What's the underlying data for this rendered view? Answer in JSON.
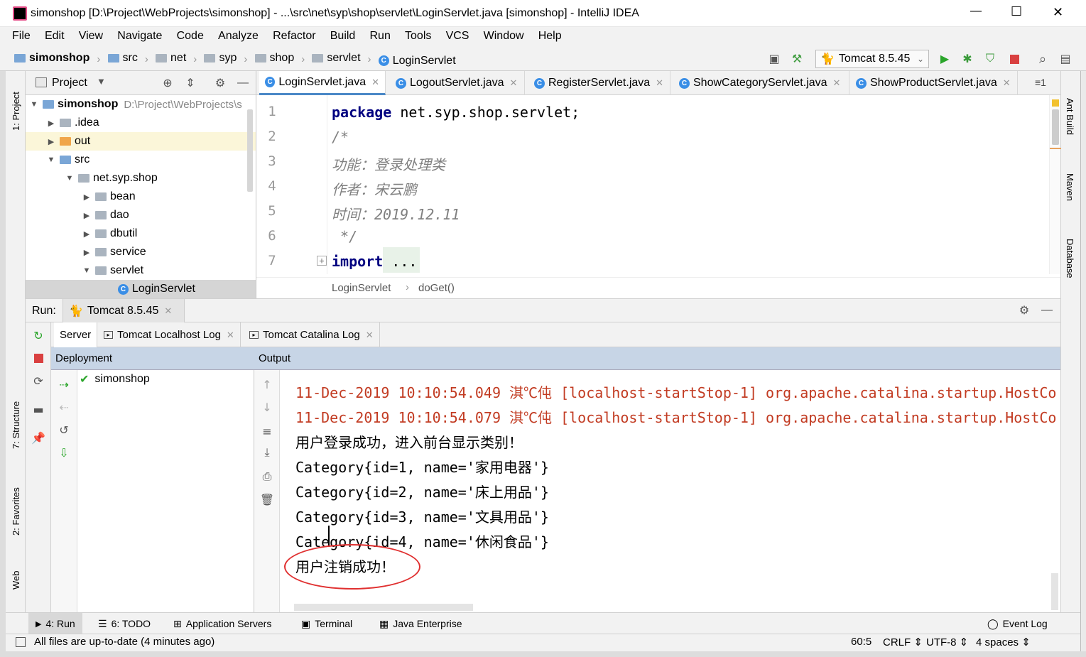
{
  "window": {
    "title": "simonshop [D:\\Project\\WebProjects\\simonshop] - ...\\src\\net\\syp\\shop\\servlet\\LoginServlet.java [simonshop] - IntelliJ IDEA",
    "minimize": "—",
    "maximize": "☐",
    "close": "✕"
  },
  "menu": [
    "File",
    "Edit",
    "View",
    "Navigate",
    "Code",
    "Analyze",
    "Refactor",
    "Build",
    "Run",
    "Tools",
    "VCS",
    "Window",
    "Help"
  ],
  "breadcrumbs": [
    "simonshop",
    "src",
    "net",
    "syp",
    "shop",
    "servlet",
    "LoginServlet"
  ],
  "run_config": "Tomcat 8.5.45",
  "project_panel": {
    "title": "Project",
    "tree": [
      {
        "label": "simonshop",
        "extra": "D:\\Project\\WebProjects\\s"
      },
      {
        "label": ".idea"
      },
      {
        "label": "out"
      },
      {
        "label": "src"
      },
      {
        "label": "net.syp.shop"
      },
      {
        "label": "bean"
      },
      {
        "label": "dao"
      },
      {
        "label": "dbutil"
      },
      {
        "label": "service"
      },
      {
        "label": "servlet"
      },
      {
        "label": "LoginServlet"
      }
    ]
  },
  "editor": {
    "tabs": [
      "LoginServlet.java",
      "LogoutServlet.java",
      "RegisterServlet.java",
      "ShowCategoryServlet.java",
      "ShowProductServlet.java"
    ],
    "tab_overflow": "≡1",
    "line_numbers": [
      "1",
      "2",
      "3",
      "4",
      "5",
      "6",
      "7"
    ],
    "lines": {
      "l1_kw": "package",
      "l1_rest": " net.syp.shop.servlet;",
      "l2": "/*",
      "l3": "功能：登录处理类",
      "l4": "作者：宋云鹏",
      "l5": "时间：2019.12.11",
      "l6": " */",
      "l7_kw": "import",
      "l7_rest": " ..."
    },
    "breadcrumb": [
      "LoginServlet",
      "doGet()"
    ]
  },
  "run_panel": {
    "label": "Run:",
    "config_tab": "Tomcat 8.5.45",
    "subtabs": [
      "Server",
      "Tomcat Localhost Log",
      "Tomcat Catalina Log"
    ],
    "deployment_header": "Deployment",
    "deployment_item": "simonshop",
    "output_header": "Output",
    "output_lines": [
      "11-Dec-2019 10:10:54.049 淇℃伅 [localhost-startStop-1] org.apache.catalina.startup.HostCo",
      "11-Dec-2019 10:10:54.079 淇℃伅 [localhost-startStop-1] org.apache.catalina.startup.HostCo",
      "用户登录成功，进入前台显示类别！",
      "Category{id=1, name='家用电器'}",
      "Category{id=2, name='床上用品'}",
      "Category{id=3, name='文具用品'}",
      "Category{id=4, name='休闲食品'}",
      "用户注销成功！"
    ]
  },
  "left_strip": [
    "1: Project",
    "7: Structure",
    "2: Favorites",
    "Web"
  ],
  "right_strip": [
    "Ant Build",
    "Maven",
    "Database"
  ],
  "bottom_tools": [
    "4: Run",
    "6: TODO",
    "Application Servers",
    "Terminal",
    "Java Enterprise",
    "Event Log"
  ],
  "status": {
    "message": "All files are up-to-date (4 minutes ago)",
    "position": "60:5",
    "line_sep": "CRLF",
    "encoding": "UTF-8",
    "indent": "4 spaces"
  },
  "colors": {
    "keyword": "#000080",
    "comment": "#808080",
    "log_red": "#c23b22",
    "header_blue": "#c7d5e6",
    "annotation_circle": "#e03030"
  }
}
